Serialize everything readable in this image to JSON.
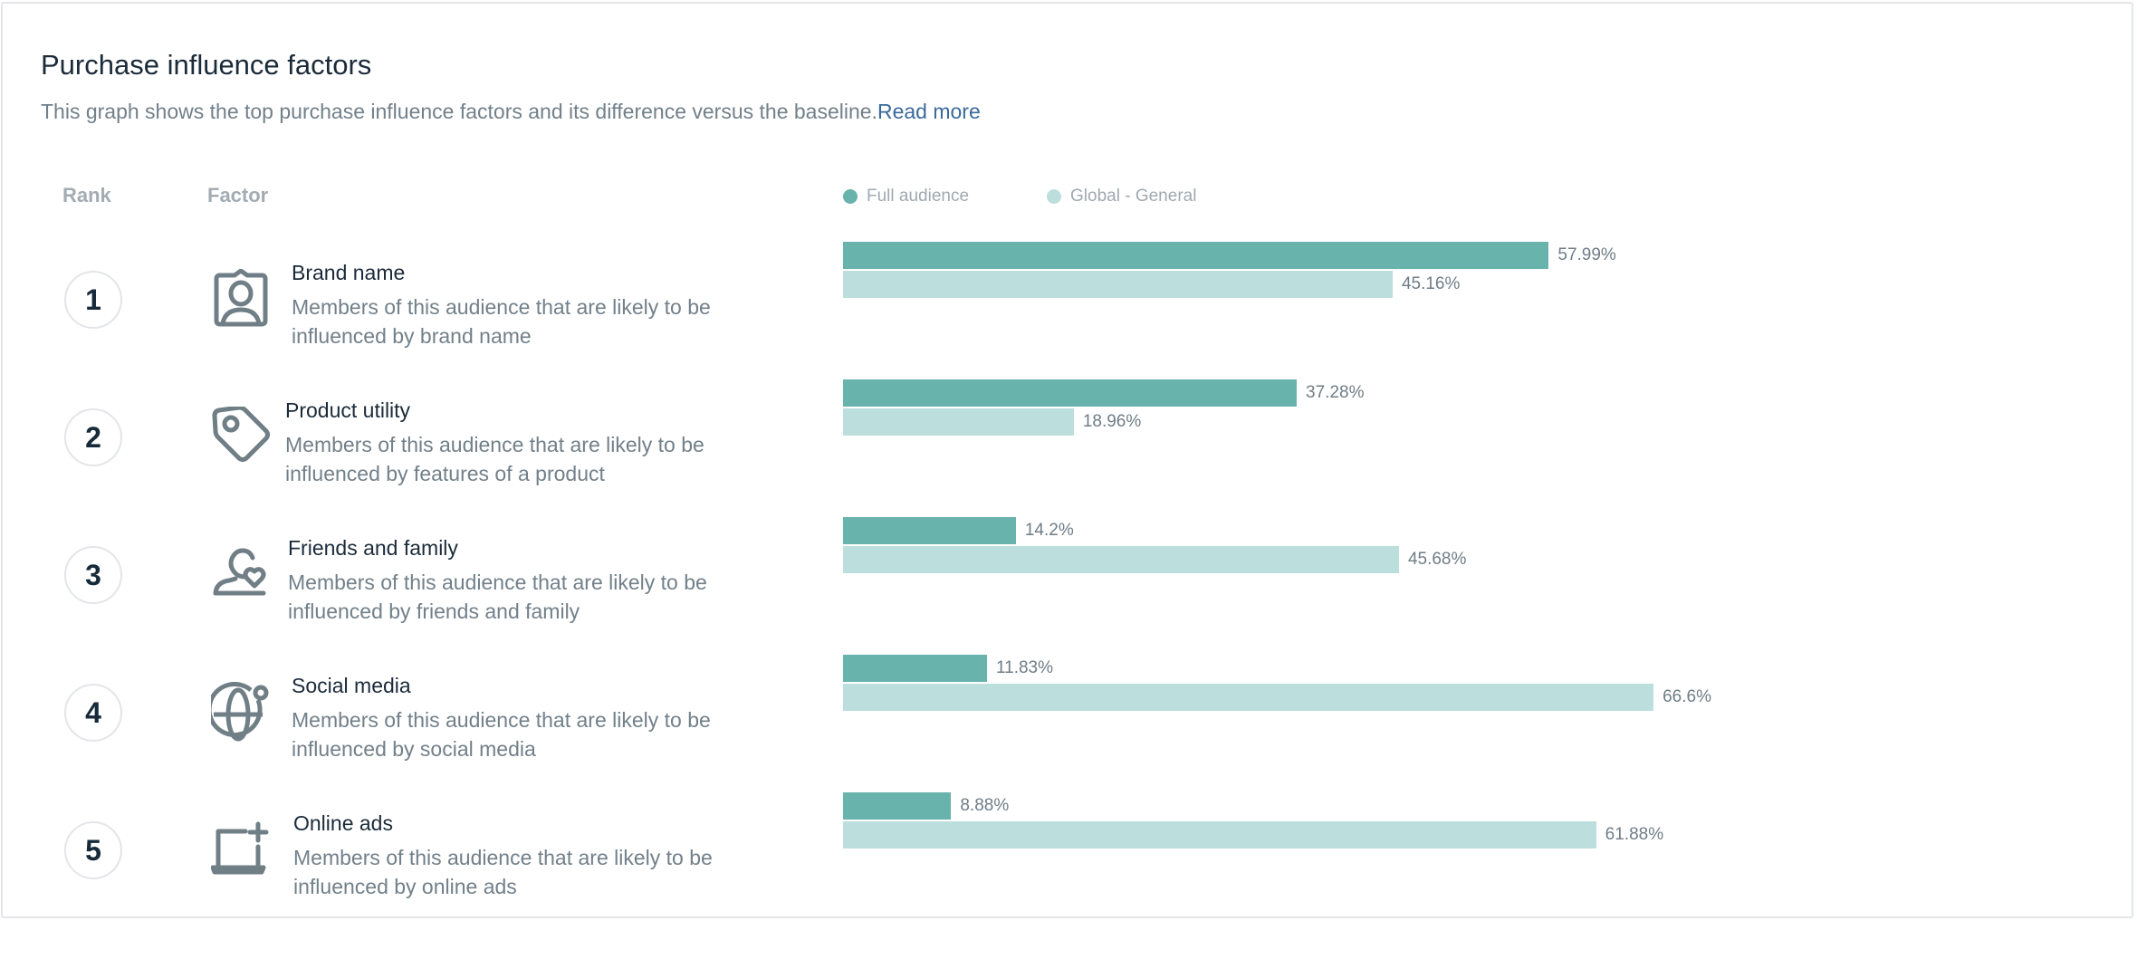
{
  "card": {
    "title": "Purchase influence factors",
    "subtitle": "This graph shows the top purchase influence factors and its difference versus the baseline.",
    "read_more": "Read more"
  },
  "headers": {
    "rank": "Rank",
    "factor": "Factor"
  },
  "colors": {
    "full_audience": "#68b3ac",
    "global_general": "#bcdfdd",
    "icon": "#707e86",
    "link": "#3a6a9b"
  },
  "chart_data": {
    "type": "bar",
    "orientation": "horizontal",
    "title": "Purchase influence factors",
    "legend": [
      "Full audience",
      "Global - General"
    ],
    "legend_position": "top-left",
    "categories": [
      "Brand name",
      "Product utility",
      "Friends and family",
      "Social media",
      "Online ads"
    ],
    "series": [
      {
        "name": "Full audience",
        "values": [
          57.99,
          37.28,
          14.2,
          11.83,
          8.88
        ],
        "labels": [
          "57.99%",
          "37.28%",
          "14.2%",
          "11.83%",
          "8.88%"
        ]
      },
      {
        "name": "Global - General",
        "values": [
          45.16,
          18.96,
          45.68,
          66.6,
          61.88
        ],
        "labels": [
          "45.16%",
          "18.96%",
          "45.68%",
          "66.6%",
          "61.88%"
        ]
      }
    ],
    "unit": "%",
    "xlim": [
      0,
      100
    ],
    "grid": false
  },
  "rows": [
    {
      "rank": "1",
      "name": "Brand name",
      "desc": "Members of this audience that are likely to be influenced by brand name",
      "icon": "id-badge-icon"
    },
    {
      "rank": "2",
      "name": "Product utility",
      "desc": "Members of this audience that are likely to be influenced by features of a product",
      "icon": "price-tag-icon"
    },
    {
      "rank": "3",
      "name": "Friends and family",
      "desc": "Members of this audience that are likely to be influenced by friends and family",
      "icon": "person-heart-icon"
    },
    {
      "rank": "4",
      "name": "Social media",
      "desc": "Members of this audience that are likely to be influenced by social media",
      "icon": "globe-notification-icon"
    },
    {
      "rank": "5",
      "name": "Online ads",
      "desc": "Members of this audience that are likely to be influenced by online ads",
      "icon": "laptop-plus-icon"
    }
  ]
}
